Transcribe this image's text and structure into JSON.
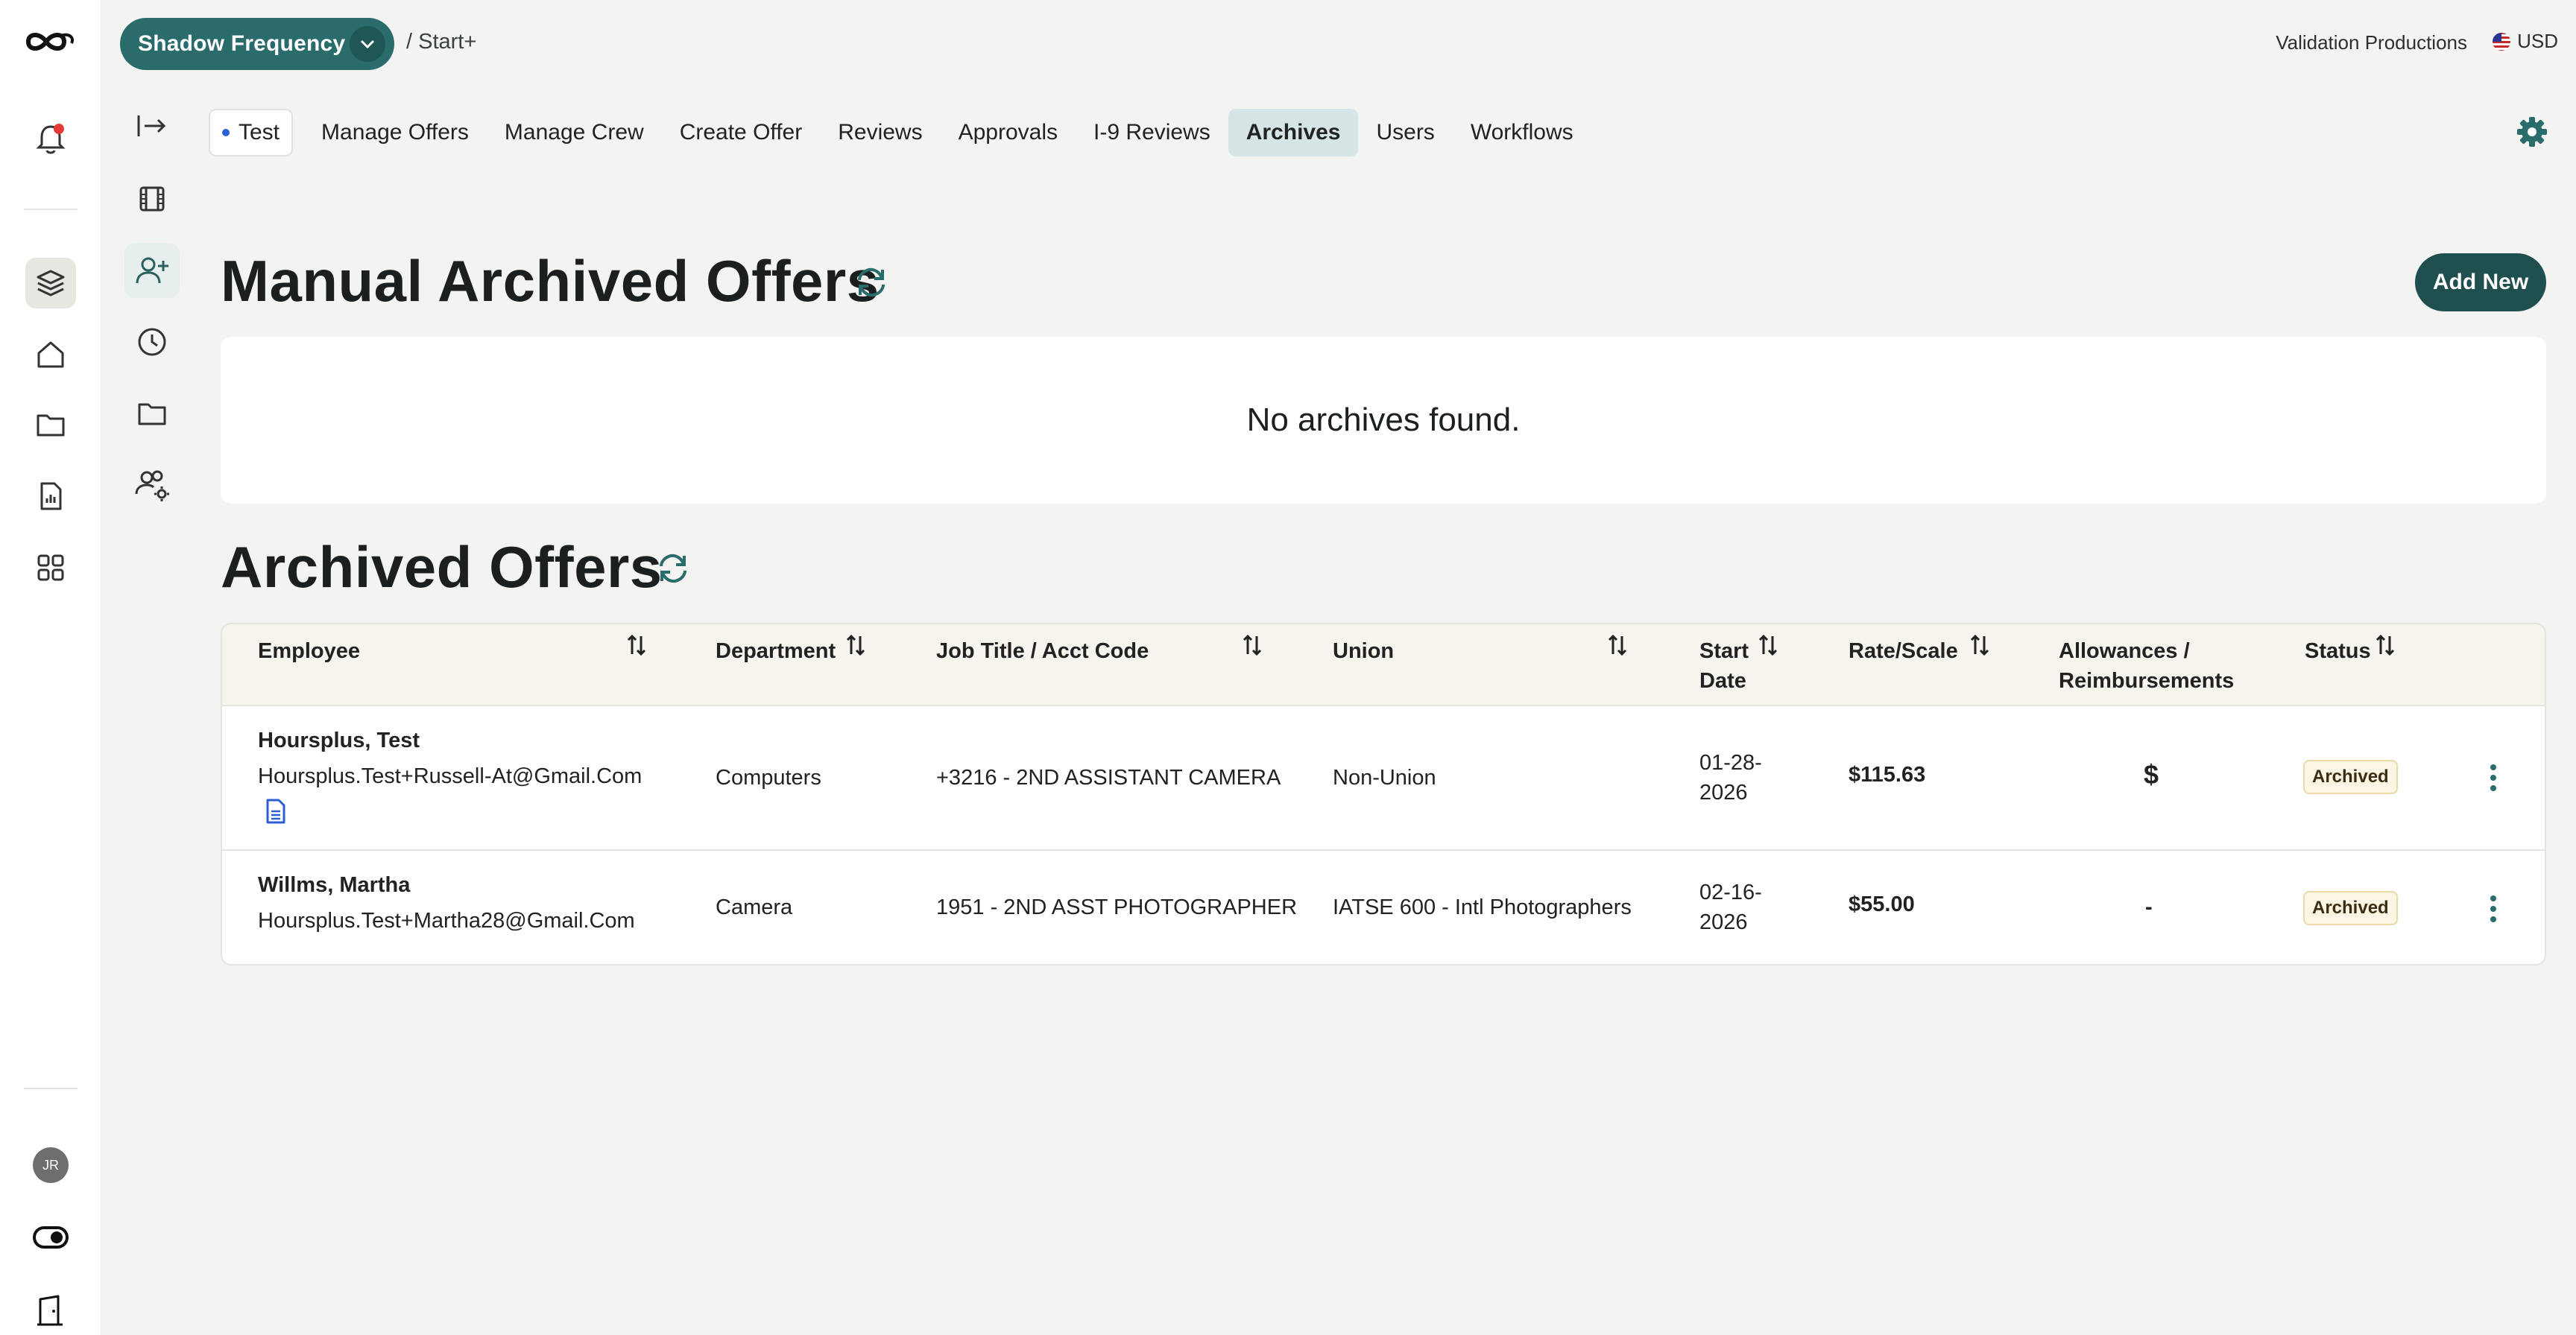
{
  "topbar": {
    "project_name": "Shadow Frequency",
    "breadcrumb": "/ Start+",
    "company": "Validation Productions",
    "currency": "USD"
  },
  "tabs": [
    {
      "label": "Test"
    },
    {
      "label": "Manage Offers"
    },
    {
      "label": "Manage Crew"
    },
    {
      "label": "Create Offer"
    },
    {
      "label": "Reviews"
    },
    {
      "label": "Approvals"
    },
    {
      "label": "I-9 Reviews"
    },
    {
      "label": "Archives",
      "active": true
    },
    {
      "label": "Users"
    },
    {
      "label": "Workflows"
    }
  ],
  "manual_section": {
    "title": "Manual Archived Offers",
    "add_button": "Add New",
    "empty_text": "No archives found."
  },
  "archived_section": {
    "title": "Archived Offers",
    "columns": {
      "employee": "Employee",
      "department": "Department",
      "job_title": "Job Title / Acct Code",
      "union": "Union",
      "start_date_l1": "Start",
      "start_date_l2": "Date",
      "rate": "Rate/Scale",
      "allowances_l1": "Allowances /",
      "allowances_l2": "Reimbursements",
      "status": "Status"
    },
    "rows": [
      {
        "name": "Hoursplus, Test",
        "email": "Hoursplus.Test+Russell-At@Gmail.Com",
        "department": "Computers",
        "job_title": "+3216 - 2ND ASSISTANT CAMERA",
        "union": "Non-Union",
        "start_l1": "01-28-",
        "start_l2": "2026",
        "rate": "$115.63",
        "allowances": "$",
        "status": "Archived"
      },
      {
        "name": "Willms, Martha",
        "email": "Hoursplus.Test+Martha28@Gmail.Com",
        "department": "Camera",
        "job_title": "1951 - 2ND ASST PHOTOGRAPHER",
        "union": "IATSE 600 - Intl Photographers",
        "start_l1": "02-16-",
        "start_l2": "2026",
        "rate": "$55.00",
        "allowances": "-",
        "status": "Archived"
      }
    ]
  },
  "user": {
    "initials": "JR"
  },
  "colors": {
    "brand_teal": "#2a6b6b",
    "active_tab": "#d5e5e6",
    "add_button": "#1f4f4f",
    "notification_dot": "#e53935"
  }
}
